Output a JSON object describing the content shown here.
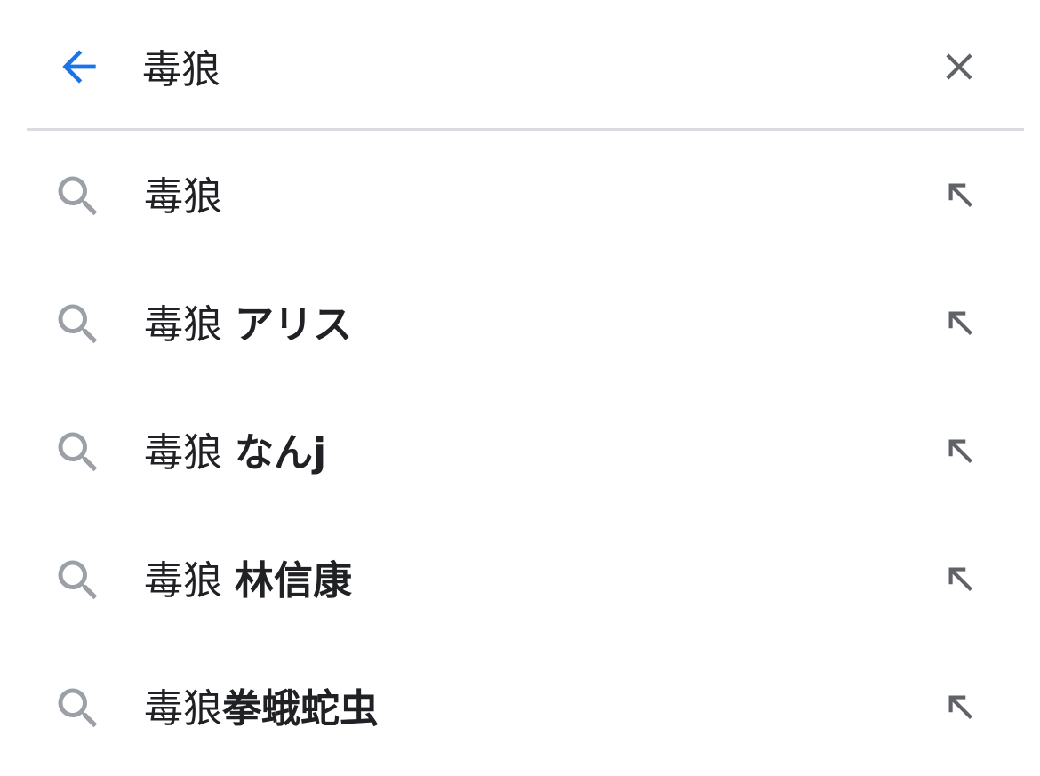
{
  "search_bar": {
    "query": "毒狼",
    "back_icon": "arrow-left-icon",
    "clear_icon": "close-icon",
    "accent_color": "#1a73e8"
  },
  "suggestions": [
    {
      "base": "毒狼",
      "completion": ""
    },
    {
      "base": "毒狼 ",
      "completion": "アリス"
    },
    {
      "base": "毒狼 ",
      "completion": "なんj"
    },
    {
      "base": "毒狼 ",
      "completion": "林信康"
    },
    {
      "base": "毒狼",
      "completion": "拳蛾蛇虫"
    }
  ],
  "icons": {
    "suggestion_icon": "search-icon",
    "fill_icon": "arrow-up-left-icon",
    "icon_color": "#9aa0a6"
  }
}
